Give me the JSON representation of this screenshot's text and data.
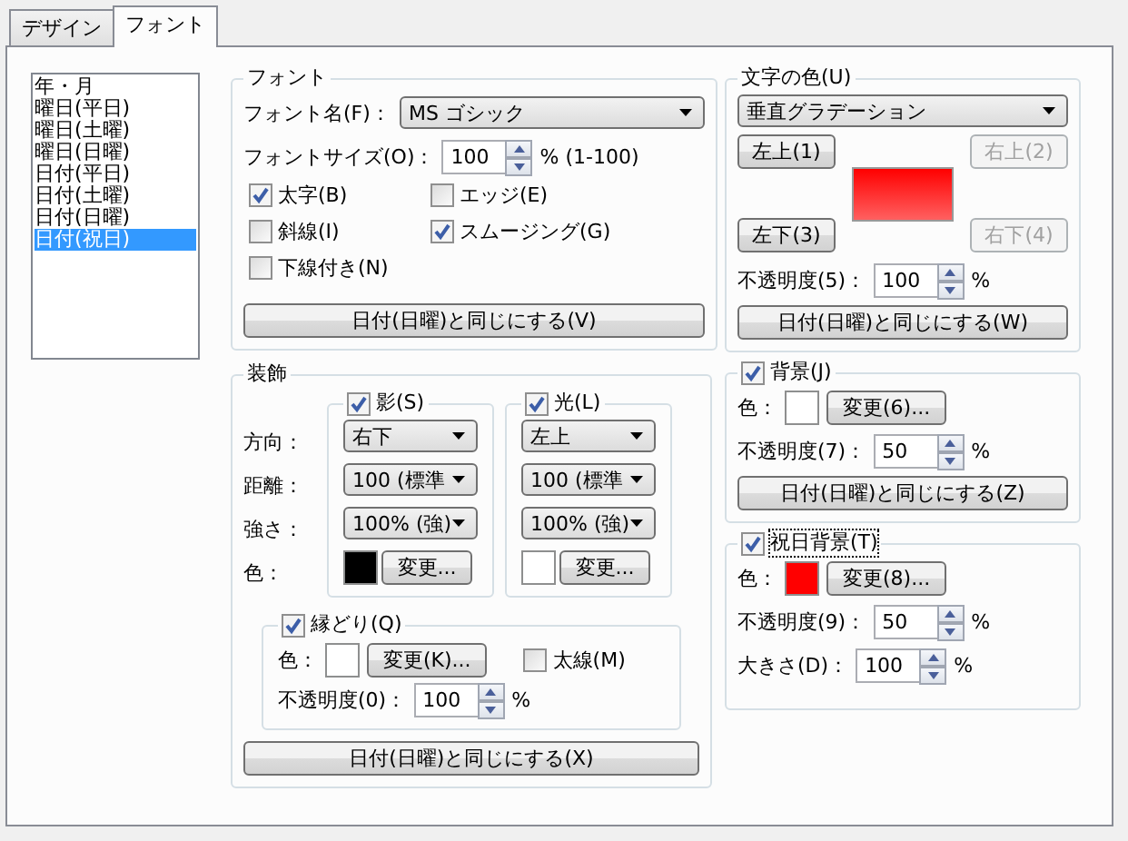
{
  "tabs": [
    {
      "label": "デザイン",
      "selected": false
    },
    {
      "label": "フォント",
      "selected": true
    }
  ],
  "list": {
    "items": [
      {
        "label": "年・月",
        "selected": false
      },
      {
        "label": "曜日(平日)",
        "selected": false
      },
      {
        "label": "曜日(土曜)",
        "selected": false
      },
      {
        "label": "曜日(日曜)",
        "selected": false
      },
      {
        "label": "日付(平日)",
        "selected": false
      },
      {
        "label": "日付(土曜)",
        "selected": false
      },
      {
        "label": "日付(日曜)",
        "selected": false
      },
      {
        "label": "日付(祝日)",
        "selected": true
      }
    ]
  },
  "font_group": {
    "title": "フォント",
    "name_label": "フォント名(F)：",
    "name_value": "MS ゴシック",
    "size_label": "フォントサイズ(O)：",
    "size_value": "100",
    "size_unit": "% (1-100)",
    "checkboxes": [
      {
        "label": "太字(B)",
        "checked": true
      },
      {
        "label": "エッジ(E)",
        "checked": false
      },
      {
        "label": "斜線(I)",
        "checked": false
      },
      {
        "label": "スムージング(G)",
        "checked": true
      },
      {
        "label": "下線付き(N)",
        "checked": false
      }
    ],
    "button": "日付(日曜)と同じにする(V)"
  },
  "decoration": {
    "title": "装飾",
    "row_labels": [
      "方向：",
      "距離：",
      "強さ：",
      "色："
    ],
    "effects": [
      {
        "label": "影(S)",
        "checked": true,
        "direction": "右下",
        "distance": "100 (標準",
        "strength": "100% (強)",
        "color": "#000000",
        "change_button": "変更..."
      },
      {
        "label": "光(L)",
        "checked": true,
        "direction": "左上",
        "distance": "100 (標準",
        "strength": "100% (強)",
        "color": "#ffffff",
        "change_button": "変更..."
      }
    ],
    "outline": {
      "label": "縁どり(Q)",
      "checked": true,
      "color_label": "色：",
      "color": "#ffffff",
      "change_button": "変更(K)...",
      "thick": {
        "label": "太線(M)",
        "checked": false
      },
      "opacity_label": "不透明度(0)：",
      "opacity": "100",
      "unit": "%"
    },
    "button": "日付(日曜)と同じにする(X)"
  },
  "text_color": {
    "title": "文字の色(U)",
    "mode": "垂直グラデーション",
    "corner_buttons": [
      {
        "label": "左上(1)",
        "disabled": false
      },
      {
        "label": "右上(2)",
        "disabled": true
      },
      {
        "label": "左下(3)",
        "disabled": false
      },
      {
        "label": "右下(4)",
        "disabled": true
      }
    ],
    "opacity_label": "不透明度(5)：",
    "opacity": "100",
    "unit": "%",
    "button": "日付(日曜)と同じにする(W)"
  },
  "background": {
    "label": "背景(J)",
    "checked": true,
    "color_label": "色：",
    "color": "#ffffff",
    "change_button": "変更(6)...",
    "opacity_label": "不透明度(7)：",
    "opacity": "50",
    "unit": "%",
    "button": "日付(日曜)と同じにする(Z)"
  },
  "holiday_background": {
    "label": "祝日背景(T)",
    "checked": true,
    "color_label": "色：",
    "color": "#ff0000",
    "change_button": "変更(8)...",
    "opacity_label": "不透明度(9)：",
    "opacity": "50",
    "unit": "%",
    "size_label": "大きさ(D)：",
    "size": "100",
    "size_unit": "%"
  }
}
